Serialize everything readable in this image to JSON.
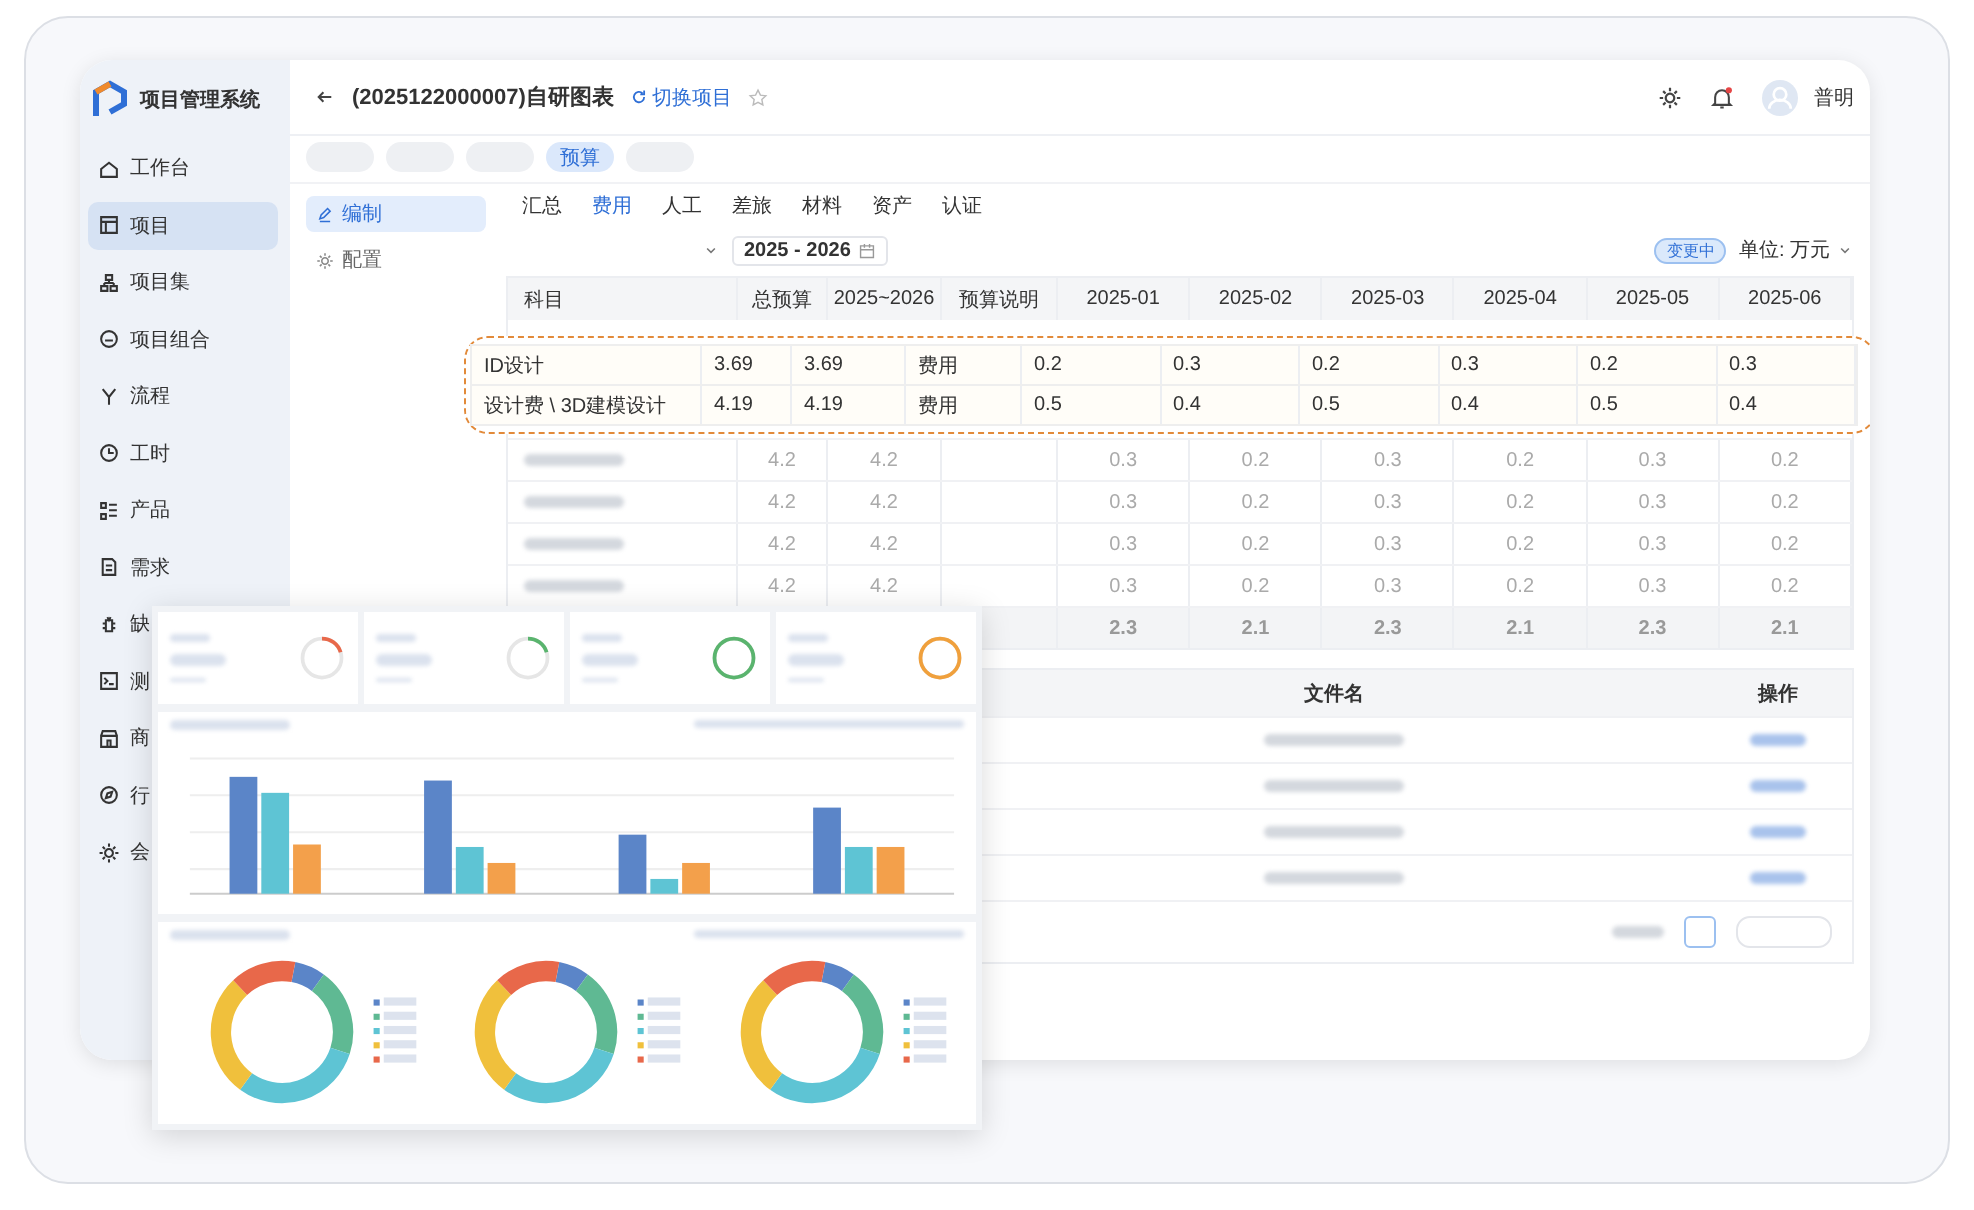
{
  "app": {
    "name": "项目管理系统"
  },
  "sidebar": {
    "items": [
      {
        "label": "工作台",
        "selected": false
      },
      {
        "label": "项目",
        "selected": true
      },
      {
        "label": "项目集",
        "selected": false
      },
      {
        "label": "项目组合",
        "selected": false
      },
      {
        "label": "流程",
        "selected": false
      },
      {
        "label": "工时",
        "selected": false
      },
      {
        "label": "产品",
        "selected": false
      },
      {
        "label": "需求",
        "selected": false
      },
      {
        "label": "缺",
        "selected": false
      },
      {
        "label": "测",
        "selected": false
      },
      {
        "label": "商",
        "selected": false
      },
      {
        "label": "行",
        "selected": false
      },
      {
        "label": "会",
        "selected": false
      }
    ]
  },
  "header": {
    "title": "(2025122000007)自研图表",
    "switch_link": "切换项目",
    "notification_dot": true,
    "user": "普明"
  },
  "stages": [
    {
      "kind": "blurred"
    },
    {
      "kind": "blurred"
    },
    {
      "kind": "blurred"
    },
    {
      "kind": "tab",
      "label": "预算",
      "selected": true
    },
    {
      "kind": "blurred"
    }
  ],
  "subnav": [
    {
      "label": "编制",
      "selected": true
    },
    {
      "label": "配置",
      "selected": false
    }
  ],
  "tabs": [
    {
      "label": "汇总",
      "selected": false
    },
    {
      "label": "费用",
      "selected": true
    },
    {
      "label": "人工",
      "selected": false
    },
    {
      "label": "差旅",
      "selected": false
    },
    {
      "label": "材料",
      "selected": false
    },
    {
      "label": "资产",
      "selected": false
    },
    {
      "label": "认证",
      "selected": false
    }
  ],
  "filter": {
    "date_range": "2025 - 2026",
    "status_badge": "变更中",
    "unit": "单位: 万元"
  },
  "budget_table": {
    "columns": [
      "科目",
      "总预算",
      "2025~2026",
      "预算说明",
      "2025-01",
      "2025-02",
      "2025-03",
      "2025-04",
      "2025-05",
      "2025-06"
    ],
    "highlighted_rows": [
      {
        "subject": "ID设计",
        "total": "3.69",
        "period": "3.69",
        "note": "费用",
        "months": [
          "0.2",
          "0.3",
          "0.2",
          "0.3",
          "0.2",
          "0.3"
        ]
      },
      {
        "subject": "设计费 \\ 3D建模设计",
        "total": "4.19",
        "period": "4.19",
        "note": "费用",
        "months": [
          "0.5",
          "0.4",
          "0.5",
          "0.4",
          "0.5",
          "0.4"
        ]
      }
    ],
    "rows": [
      {
        "total": "4.2",
        "period": "4.2",
        "months": [
          "0.3",
          "0.2",
          "0.3",
          "0.2",
          "0.3",
          "0.2"
        ]
      },
      {
        "total": "4.2",
        "period": "4.2",
        "months": [
          "0.3",
          "0.2",
          "0.3",
          "0.2",
          "0.3",
          "0.2"
        ]
      },
      {
        "total": "4.2",
        "period": "4.2",
        "months": [
          "0.3",
          "0.2",
          "0.3",
          "0.2",
          "0.3",
          "0.2"
        ]
      },
      {
        "total": "4.2",
        "period": "4.2",
        "months": [
          "0.3",
          "0.2",
          "0.3",
          "0.2",
          "0.3",
          "0.2"
        ]
      }
    ],
    "total_row": {
      "months": [
        "2.3",
        "2.1",
        "2.3",
        "2.1",
        "2.3",
        "2.1"
      ]
    }
  },
  "files_table": {
    "columns": [
      "文件名",
      "操作"
    ],
    "rows": [
      {
        "kind": "blurred"
      },
      {
        "kind": "blurred"
      },
      {
        "kind": "blurred"
      },
      {
        "kind": "blurred"
      }
    ]
  },
  "dashboard": {
    "kpis": [
      {
        "level": 0.2,
        "color": "#e8684a"
      },
      {
        "level": 0.2,
        "color": "#5ab46e"
      },
      {
        "level": 1,
        "color": "#5ab46e"
      },
      {
        "level": 1,
        "color": "#f0a03c"
      }
    ]
  }
}
